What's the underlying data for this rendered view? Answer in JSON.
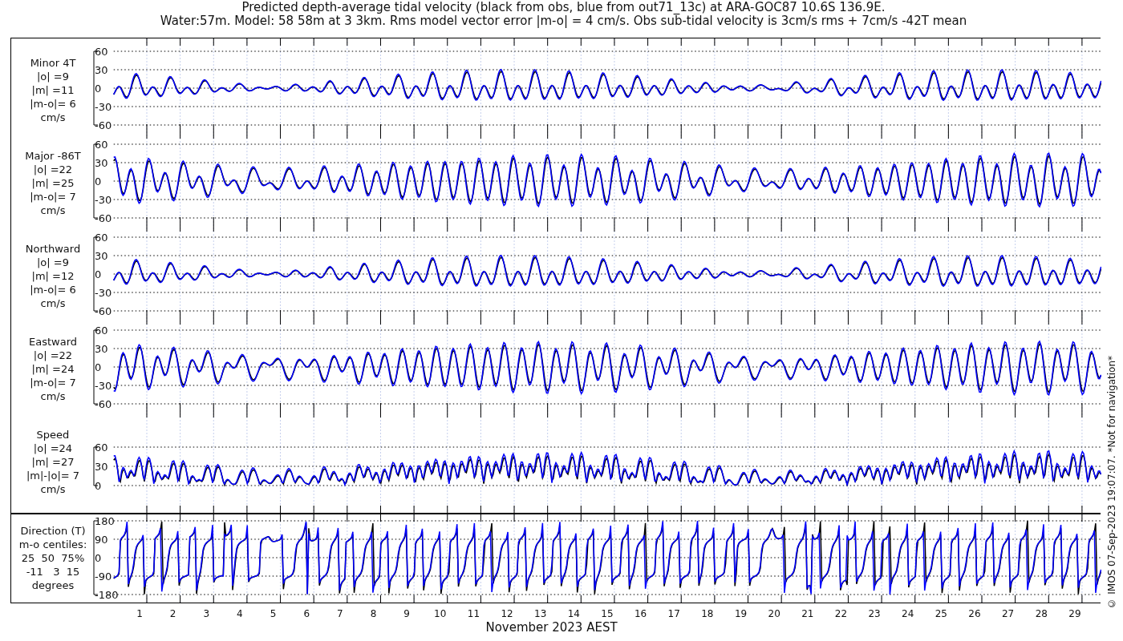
{
  "title_lines": [
    "Predicted depth-average tidal velocity (black from obs, blue from out71_13c) at ARA-GOC87 10.6S 136.9E.",
    "Water:57m. Model: 58 58m at 3 3km. Rms model vector error |m-o| = 4 cm/s. Obs sub-tidal velocity is 3cm/s rms + 7cm/s -42T mean"
  ],
  "panels": [
    {
      "kind": "minor",
      "label_lines": [
        "Minor 4T",
        "|o| =9",
        "|m| =11",
        "|m-o|= 6",
        "cm/s"
      ],
      "yticks": [
        "60",
        "30",
        "0",
        "-30",
        "-60"
      ]
    },
    {
      "kind": "major",
      "label_lines": [
        "Major -86T",
        "|o| =22",
        "|m| =25",
        "|m-o|= 7",
        "cm/s"
      ],
      "yticks": [
        "60",
        "30",
        "0",
        "-30",
        "-60"
      ]
    },
    {
      "kind": "north",
      "label_lines": [
        "Northward",
        "|o| =9",
        "|m| =12",
        "|m-o|= 6",
        "cm/s"
      ],
      "yticks": [
        "60",
        "30",
        "0",
        "-30",
        "-60"
      ]
    },
    {
      "kind": "east",
      "label_lines": [
        "Eastward",
        "|o| =22",
        "|m| =24",
        "|m-o|= 7",
        "cm/s"
      ],
      "yticks": [
        "60",
        "30",
        "0",
        "-30",
        "-60"
      ]
    },
    {
      "kind": "speed",
      "label_lines": [
        "Speed",
        "|o| =24",
        "|m| =27",
        "|m|-|o|= 7",
        "cm/s"
      ],
      "yticks": [
        "60",
        "30",
        "0"
      ]
    },
    {
      "kind": "direction",
      "label_lines": [
        "Direction (T)",
        "m-o centiles:",
        "25  50  75%",
        "-11   3  15",
        "degrees"
      ],
      "yticks": [
        "180",
        "90",
        "0",
        "-90",
        "-180"
      ]
    }
  ],
  "day_labels": [
    "1",
    "2",
    "3",
    "4",
    "5",
    "6",
    "7",
    "8",
    "9",
    "10",
    "11",
    "12",
    "13",
    "14",
    "15",
    "16",
    "17",
    "18",
    "19",
    "20",
    "21",
    "22",
    "23",
    "24",
    "25",
    "26",
    "27",
    "28",
    "29"
  ],
  "x_label": "November 2023 AEST",
  "credit": "© IMOS 07-Sep-2023 19:07:07. *Not for navigation*"
}
